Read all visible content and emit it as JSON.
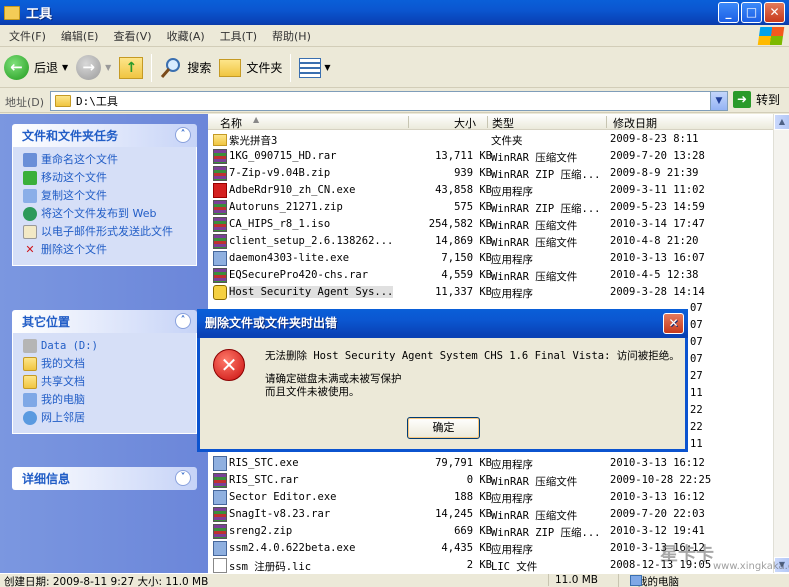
{
  "window": {
    "title": "工具",
    "min": "_",
    "max": "□",
    "close": "✕"
  },
  "menu": [
    "文件(F)",
    "编辑(E)",
    "查看(V)",
    "收藏(A)",
    "工具(T)",
    "帮助(H)"
  ],
  "toolbar": {
    "back": "后退",
    "search": "搜索",
    "folders": "文件夹"
  },
  "address": {
    "label": "地址(D)",
    "value": "D:\\工具",
    "go": "转到"
  },
  "left": {
    "tasks": {
      "title": "文件和文件夹任务",
      "items": [
        "重命名这个文件",
        "移动这个文件",
        "复制这个文件",
        "将这个文件发布到 Web",
        "以电子邮件形式发送此文件",
        "删除这个文件"
      ]
    },
    "places": {
      "title": "其它位置",
      "items": [
        "Data (D:)",
        "我的文档",
        "共享文档",
        "我的电脑",
        "网上邻居"
      ]
    },
    "details": {
      "title": "详细信息"
    }
  },
  "columns": {
    "name": "名称",
    "size": "大小",
    "type": "类型",
    "date": "修改日期"
  },
  "files_top": [
    {
      "name": "紫光拼音3",
      "size": "",
      "type": "文件夹",
      "date": "2009-8-23 8:11",
      "icon": "folder"
    },
    {
      "name": "1KG_090715_HD.rar",
      "size": "13,711 KB",
      "type": "WinRAR 压缩文件",
      "date": "2009-7-20 13:28",
      "icon": "rar"
    },
    {
      "name": "7-Zip-v9.04B.zip",
      "size": "939 KB",
      "type": "WinRAR ZIP 压缩...",
      "date": "2009-8-9 21:39",
      "icon": "rar"
    },
    {
      "name": "AdbeRdr910_zh_CN.exe",
      "size": "43,858 KB",
      "type": "应用程序",
      "date": "2009-3-11 11:02",
      "icon": "pdf"
    },
    {
      "name": "Autoruns_21271.zip",
      "size": "575 KB",
      "type": "WinRAR ZIP 压缩...",
      "date": "2009-5-23 14:59",
      "icon": "rar"
    },
    {
      "name": "CA_HIPS_r8_1.iso",
      "size": "254,582 KB",
      "type": "WinRAR 压缩文件",
      "date": "2010-3-14 17:47",
      "icon": "rar"
    },
    {
      "name": "client_setup_2.6.138262...",
      "size": "14,869 KB",
      "type": "WinRAR 压缩文件",
      "date": "2010-4-8 21:20",
      "icon": "rar"
    },
    {
      "name": "daemon4303-lite.exe",
      "size": "7,150 KB",
      "type": "应用程序",
      "date": "2010-3-13 16:07",
      "icon": "exe"
    },
    {
      "name": "EQSecurePro420-chs.rar",
      "size": "4,559 KB",
      "type": "WinRAR 压缩文件",
      "date": "2010-4-5 12:38",
      "icon": "rar"
    },
    {
      "name": "Host Security Agent Sys...",
      "size": "11,337 KB",
      "type": "应用程序",
      "date": "2009-3-28 14:14",
      "icon": "shield"
    }
  ],
  "hidden_fragments": [
    "07",
    "07",
    "07",
    "07",
    "27",
    "11",
    "22",
    "22",
    "11"
  ],
  "files_bottom": [
    {
      "name": "RIS_STC.exe",
      "size": "79,791 KB",
      "type": "应用程序",
      "date": "2010-3-13 16:12",
      "icon": "exe"
    },
    {
      "name": "RIS_STC.rar",
      "size": "0 KB",
      "type": "WinRAR 压缩文件",
      "date": "2009-10-28 22:25",
      "icon": "rar"
    },
    {
      "name": "Sector Editor.exe",
      "size": "188 KB",
      "type": "应用程序",
      "date": "2010-3-13 16:12",
      "icon": "exe"
    },
    {
      "name": "SnagIt-v8.23.rar",
      "size": "14,245 KB",
      "type": "WinRAR 压缩文件",
      "date": "2009-7-20 22:03",
      "icon": "rar"
    },
    {
      "name": "sreng2.zip",
      "size": "669 KB",
      "type": "WinRAR ZIP 压缩...",
      "date": "2010-3-12 19:41",
      "icon": "rar"
    },
    {
      "name": "ssm2.4.0.622beta.exe",
      "size": "4,435 KB",
      "type": "应用程序",
      "date": "2010-3-13 16:12",
      "icon": "exe"
    },
    {
      "name": "ssm 注册码.lic",
      "size": "2 KB",
      "type": "LIC 文件",
      "date": "2008-12-13 19:05",
      "icon": "file"
    }
  ],
  "dialog": {
    "title": "删除文件或文件夹时出错",
    "line1": "无法删除 Host Security Agent System CHS 1.6 Final Vista: 访问被拒绝。",
    "line2": "请确定磁盘未满或未被写保护",
    "line3": "而且文件未被使用。",
    "ok": "确定"
  },
  "status": {
    "left": "创建日期: 2009-8-11 9:27 大小: 11.0 MB",
    "size": "11.0 MB",
    "location": "我的电脑"
  },
  "watermark": {
    "main": "星卡卡",
    "sub": "www.xingkaka.com"
  }
}
